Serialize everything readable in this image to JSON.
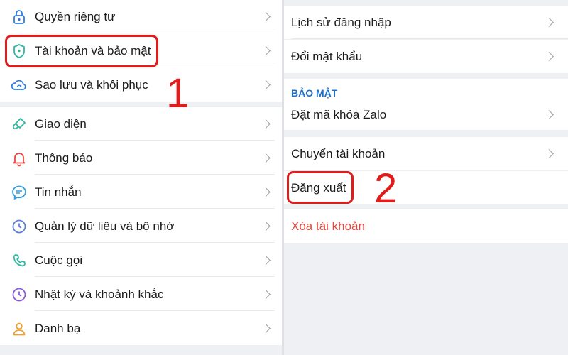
{
  "left_menu": [
    {
      "label": "Quyền riêng tư",
      "icon": "lock-icon"
    },
    {
      "label": "Tài khoản và bảo mật",
      "icon": "shield-icon"
    },
    {
      "label": "Sao lưu và khôi phục",
      "icon": "cloud-sync-icon"
    },
    {
      "label": "Giao diện",
      "icon": "paint-brush-icon"
    },
    {
      "label": "Thông báo",
      "icon": "bell-icon"
    },
    {
      "label": "Tin nhắn",
      "icon": "chat-bubble-icon"
    },
    {
      "label": "Quản lý dữ liệu và bộ nhớ",
      "icon": "clock-icon"
    },
    {
      "label": "Cuộc gọi",
      "icon": "phone-icon"
    },
    {
      "label": "Nhật ký và khoảnh khắc",
      "icon": "clock-icon"
    },
    {
      "label": "Danh bạ",
      "icon": "contact-person-icon"
    }
  ],
  "right_menu": {
    "login_history": "Lịch sử đăng nhập",
    "change_password": "Đổi mật khẩu",
    "security_title": "BẢO MẬT",
    "zalo_lock": "Đặt mã khóa Zalo",
    "switch_account": "Chuyển tài khoản",
    "logout": "Đăng xuất",
    "delete_account": "Xóa tài khoản"
  },
  "annotations": {
    "step1": "1",
    "step2": "2"
  },
  "colors": {
    "accent_blue": "#1e6fc8",
    "icon_blue": "#2f7de1",
    "danger_red": "#e8463c",
    "highlight_red": "#e21b1b",
    "icon_green": "#2eb8a0",
    "icon_orange": "#f0a12c",
    "icon_purple": "#8a5ad6"
  }
}
